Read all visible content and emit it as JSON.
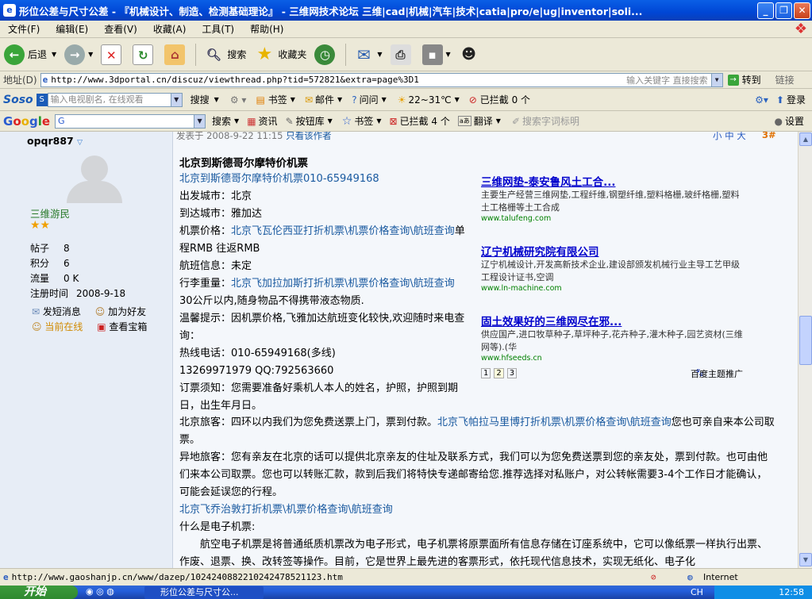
{
  "window": {
    "title": "形位公差与尺寸公差 - 『机械设计、制造、检测基础理论』 - 三维网技术论坛 三维|cad|机械|汽车|技术|catia|pro/e|ug|inventor|soli..."
  },
  "menu": [
    "文件(F)",
    "编辑(E)",
    "查看(V)",
    "收藏(A)",
    "工具(T)",
    "帮助(H)"
  ],
  "toolbar": {
    "back": "后退",
    "search": "搜索",
    "favorites": "收藏夹"
  },
  "address": {
    "label": "地址(D)",
    "url": "http://www.3dportal.cn/discuz/viewthread.php?tid=572821&extra=page%3D1",
    "search_placeholder": "输入关键字 直接搜索",
    "go": "转到",
    "links": "链接"
  },
  "soso_bar": {
    "input_placeholder": "输入电视剧名, 在线观看",
    "search": "搜搜",
    "bookmarks": "书签",
    "mail": "邮件",
    "ask": "问问",
    "weather": "22~31℃",
    "blocked": "已拦截 0 个",
    "login": "登录"
  },
  "google_bar": {
    "search": "搜索",
    "news": "资讯",
    "buttons": "按钮库",
    "bookmarks": "书签",
    "blocked": "已拦截 4 个",
    "translate": "翻译",
    "suggest": "搜索字词标明",
    "settings": "设置"
  },
  "user": {
    "username": "opqr887",
    "group": "三维游民",
    "stats": [
      {
        "label": "帖子",
        "value": "8"
      },
      {
        "label": "积分",
        "value": "6"
      },
      {
        "label": "流量",
        "value": "0 K"
      },
      {
        "label": "注册时间",
        "value": "2008-9-18"
      }
    ],
    "actions": [
      "发短消息",
      "加为好友",
      "当前在线",
      "查看宝箱"
    ]
  },
  "post": {
    "meta": "发表于 2008-9-22 11:15",
    "only_author": "只看该作者",
    "font_size": "小 中 大",
    "floor": "3#",
    "title": "北京到斯德哥尔摩特价机票",
    "lines": [
      {
        "link": "北京到斯德哥尔摩特价机票010-65949168",
        "text": ""
      },
      {
        "text": "出发城市：北京"
      },
      {
        "text": "到达城市：雅加达"
      },
      {
        "text": "机票价格：",
        "link": "北京飞瓦伦西亚打折机票\\机票价格查询\\航班查询",
        "after": "单程RMB  往返RMB"
      },
      {
        "text": "航班信息：未定"
      },
      {
        "text": "行李重量：",
        "link": "北京飞加拉加斯打折机票\\机票价格查询\\航班查询",
        "after": "30公斤以内,随身物品不得携带液态物质."
      },
      {
        "text": "温馨提示：因机票价格,飞雅加达航班变化较快,欢迎随时来电查询："
      },
      {
        "text": "热线电话：010-65949168(多线)"
      },
      {
        "text": "13269971979  QQ:792563660"
      },
      {
        "text": "订票须知：您需要准备好乘机人本人的姓名，护照，护照到期日，出生年月日。"
      }
    ],
    "beijing": {
      "before": "北京旅客：四环以内我们为您免费送票上门，票到付款。",
      "link": "北京飞帕拉马里博打折机票\\机票价格查询\\航班查询",
      "after": "您也可亲自来本公司取票。"
    },
    "remote": "异地旅客：您有亲友在北京的话可以提供北京亲友的住址及联系方式，我们可以为您免费送票到您的亲友处，票到付款。也可由他们来本公司取票。您也可以转账汇款，款到后我们将特快专递邮寄给您.推荐选择对私账户，对公转帐需要3-4个工作日才能确认，可能会延误您的行程。",
    "remote_link": "北京飞乔治敦打折机票\\机票价格查询\\航班查询",
    "eticket_q": "什么是电子机票:",
    "eticket_a": "航空电子机票是将普通纸质机票改为电子形式，电子机票将原票面所有信息存储在订座系统中，它可以像纸票一样执行出票、作废、退票、换、改转签等操作。目前，它是世界上最先进的客票形式，依托现代信息技术，实现无纸化、电子化"
  },
  "ads": [
    {
      "title": "三维网垫-泰安鲁风土工合...",
      "desc": "主要生产经营三维网垫,工程纤维,钢塑纤维,塑料格栅,玻纤格栅,塑料土工格栅等土工合成",
      "url": "www.talufeng.com"
    },
    {
      "title": "辽宁机械研究院有限公司",
      "desc": "辽宁机械设计,开发高新技术企业,建设部颁发机械行业主导工艺甲级工程设计证书,空调",
      "url": "www.ln-machine.com"
    },
    {
      "title": "固土效果好的三维网尽在邪...",
      "desc": "供应国产,进口牧草种子,草坪种子,花卉种子,灌木种子,园艺资材(三维网等).(华",
      "url": "www.hfseeds.cn"
    }
  ],
  "ad_pages": [
    "1",
    "2",
    "3"
  ],
  "ad_brand": "百度主题推广",
  "status": {
    "url": "http://www.gaoshanjp.cn/www/dazep/1024240882210242478521123.htm",
    "zone": "Internet"
  },
  "taskbar": {
    "start": "开始",
    "task": "形位公差与尺寸公...",
    "lang": "CH",
    "clock": "12:58"
  }
}
